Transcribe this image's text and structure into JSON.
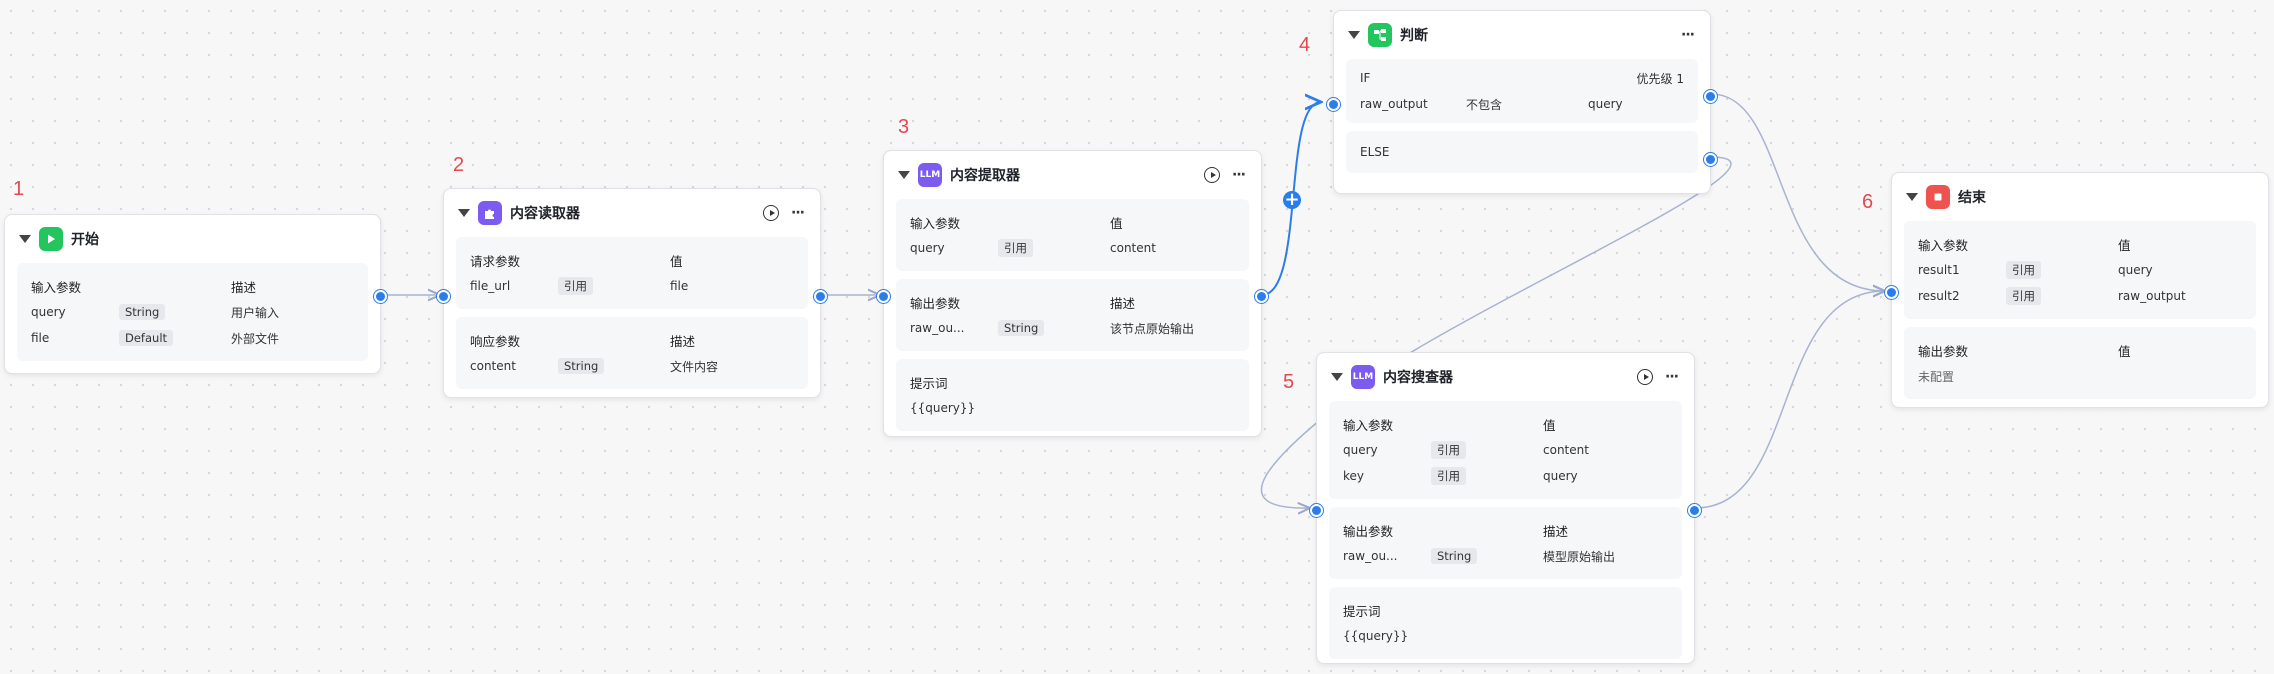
{
  "colors": {
    "accent": "#2b7de9",
    "step_number": "#e5484d",
    "start_icon": "#22c55e",
    "plugin_icon": "#7c5cf0",
    "llm_icon": "#7c5cf0",
    "condition_icon": "#22c55e",
    "end_icon": "#ef5350"
  },
  "step_numbers": [
    "1",
    "2",
    "3",
    "4",
    "5",
    "6"
  ],
  "nodes": {
    "start": {
      "title": "开始",
      "icon": "play-icon",
      "inputs": {
        "h1": "输入参数",
        "h2": "描述",
        "rows": [
          {
            "name": "query",
            "type": "String",
            "desc": "用户输入"
          },
          {
            "name": "file",
            "type": "Default",
            "desc": "外部文件"
          }
        ]
      }
    },
    "reader": {
      "title": "内容读取器",
      "icon": "puzzle-icon",
      "request": {
        "h1": "请求参数",
        "h2": "值",
        "rows": [
          {
            "name": "file_url",
            "type": "引用",
            "value": "file"
          }
        ]
      },
      "response": {
        "h1": "响应参数",
        "h2": "描述",
        "rows": [
          {
            "name": "content",
            "type": "String",
            "desc": "文件内容"
          }
        ]
      }
    },
    "extractor": {
      "title": "内容提取器",
      "icon_text": "LLM",
      "inputs": {
        "h1": "输入参数",
        "h2": "值",
        "rows": [
          {
            "name": "query",
            "type": "引用",
            "value": "content"
          }
        ]
      },
      "outputs": {
        "h1": "输出参数",
        "h2": "描述",
        "rows": [
          {
            "name": "raw_ou...",
            "type": "String",
            "desc": "该节点原始输出"
          }
        ]
      },
      "prompt": {
        "label": "提示词",
        "value": "{{query}}"
      }
    },
    "condition": {
      "title": "判断",
      "icon": "branch-icon",
      "if_label": "IF",
      "priority": "优先级 1",
      "if_rule": {
        "left": "raw_output",
        "op": "不包含",
        "right": "query"
      },
      "else_label": "ELSE"
    },
    "searcher": {
      "title": "内容搜查器",
      "icon_text": "LLM",
      "inputs": {
        "h1": "输入参数",
        "h2": "值",
        "rows": [
          {
            "name": "query",
            "type": "引用",
            "value": "content"
          },
          {
            "name": "key",
            "type": "引用",
            "value": "query"
          }
        ]
      },
      "outputs": {
        "h1": "输出参数",
        "h2": "描述",
        "rows": [
          {
            "name": "raw_ou...",
            "type": "String",
            "desc": "模型原始输出"
          }
        ]
      },
      "prompt": {
        "label": "提示词",
        "value": "{{query}}"
      }
    },
    "end": {
      "title": "结束",
      "icon": "stop-icon",
      "inputs": {
        "h1": "输入参数",
        "h2": "值",
        "rows": [
          {
            "name": "result1",
            "type": "引用",
            "value": "query"
          },
          {
            "name": "result2",
            "type": "引用",
            "value": "raw_output"
          }
        ]
      },
      "outputs": {
        "h1": "输出参数",
        "h2": "值",
        "empty": "未配置"
      }
    }
  }
}
